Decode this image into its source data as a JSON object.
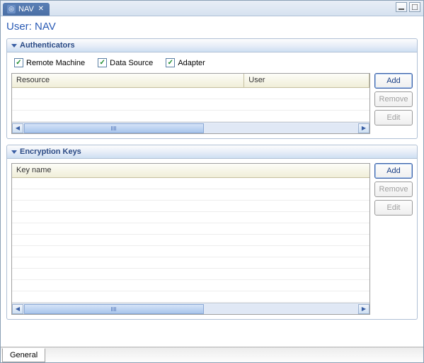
{
  "titlebar": {
    "tab_label": "NAV",
    "tab_icon": "user-icon"
  },
  "page_title": "User: NAV",
  "sections": {
    "authenticators": {
      "title": "Authenticators",
      "checkboxes": [
        {
          "label": "Remote Machine",
          "checked": true
        },
        {
          "label": "Data Source",
          "checked": true
        },
        {
          "label": "Adapter",
          "checked": true
        }
      ],
      "columns": {
        "resource": "Resource",
        "user": "User"
      },
      "buttons": {
        "add": "Add",
        "remove": "Remove",
        "edit": "Edit"
      }
    },
    "encryption": {
      "title": "Encryption Keys",
      "columns": {
        "key_name": "Key name"
      },
      "buttons": {
        "add": "Add",
        "remove": "Remove",
        "edit": "Edit"
      }
    }
  },
  "bottom_tab": "General"
}
